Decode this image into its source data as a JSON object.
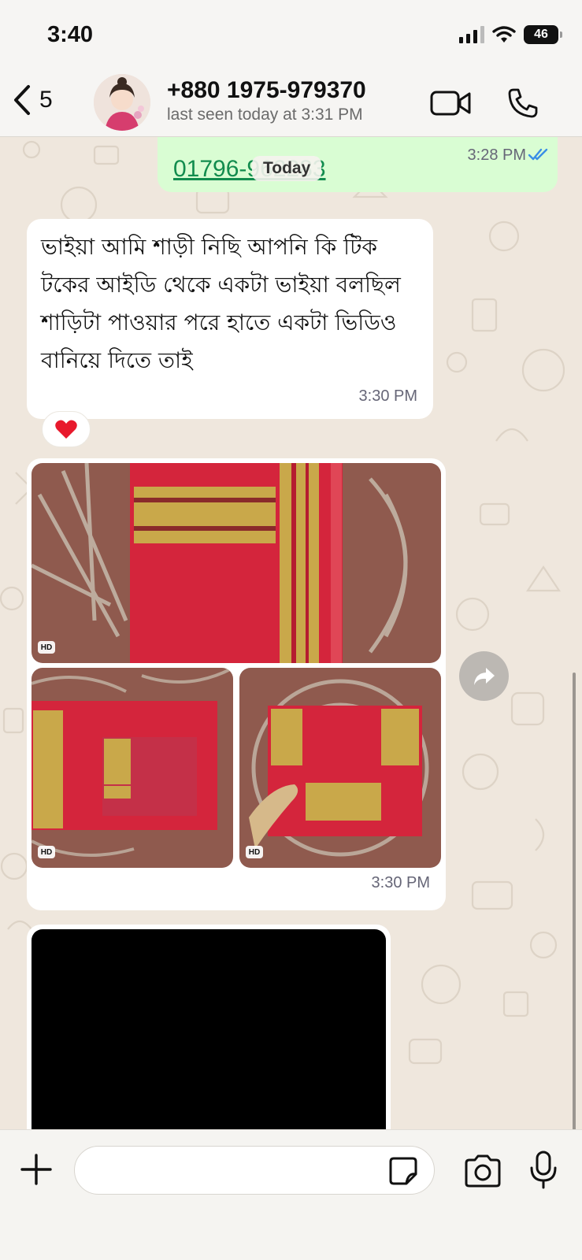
{
  "status_bar": {
    "time": "3:40",
    "battery": "46"
  },
  "header": {
    "back_count": "5",
    "contact_name": "+880 1975-979370",
    "last_seen": "last seen today at 3:31 PM"
  },
  "messages": {
    "outgoing": {
      "link_text": "01796-962283",
      "time": "3:28 PM",
      "status": "read"
    },
    "date_chip": "Today",
    "incoming_text": {
      "text": "ভাইয়া আমি শাড়ী নিছি আপনি কি টিক টকের আইডি থেকে একটা ভাইয়া বলছিল শাড়িটা পাওয়ার পরে হাতে একটা ভিডিও বানিয়ে দিতে তাই",
      "time": "3:30 PM",
      "reaction": "❤️"
    },
    "album": {
      "time": "3:30 PM",
      "photos": [
        {
          "name": "saree-photo-1",
          "badge": "HD"
        },
        {
          "name": "saree-photo-2",
          "badge": "HD"
        },
        {
          "name": "saree-photo-3",
          "badge": "HD"
        }
      ]
    }
  },
  "composer": {
    "placeholder": ""
  },
  "colors": {
    "outgoing_bubble": "#d9fdd3",
    "incoming_bubble": "#ffffff",
    "link_green": "#128c4e",
    "tick_blue": "#3a8ee6",
    "saree_red": "#d4253c",
    "zari_gold": "#c9a84a"
  }
}
